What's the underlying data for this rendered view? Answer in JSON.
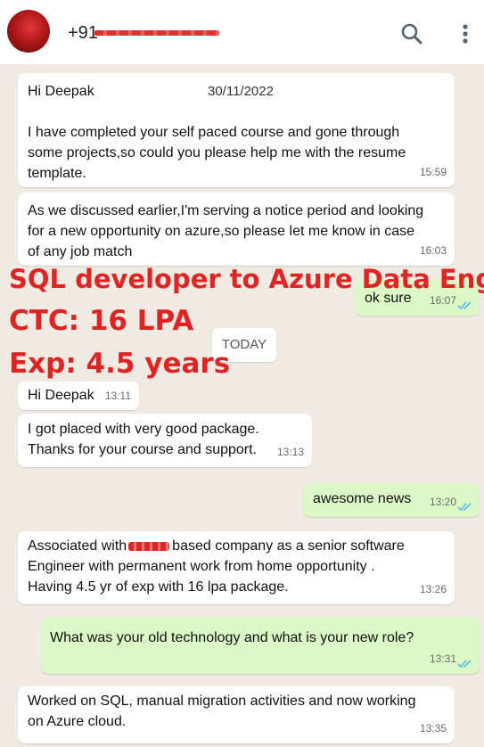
{
  "header": {
    "contact_name": "+91",
    "icons": {
      "search": "search-icon",
      "menu": "more-vertical-icon"
    }
  },
  "messages": [
    {
      "dir": "in",
      "lines": [
        "Hi Deepak",
        "",
        "I have completed your self paced course and gone through",
        "some projects,so could you please help me with the resume",
        "template."
      ],
      "date": "30/11/2022",
      "time": "15:59"
    },
    {
      "dir": "in",
      "lines": [
        "As we discussed earlier,I'm serving a notice period and looking",
        "for a new opportunity on azure,so please let me know in case",
        "of any job match"
      ],
      "time": "16:03"
    },
    {
      "dir": "out",
      "text": "ok sure",
      "time": "16:07"
    },
    {
      "dir": "in",
      "text": "Hi Deepak",
      "time": "13:11"
    },
    {
      "dir": "in",
      "lines": [
        "I got placed with very good package.",
        "Thanks for your course and support."
      ],
      "time": "13:13"
    },
    {
      "dir": "out",
      "text": "awesome news",
      "time": "13:20"
    },
    {
      "dir": "in",
      "line1_before": "Associated with",
      "line1_after": "based company as a senior software",
      "lines": [
        "Engineer with permanent work from home opportunity .",
        "Having 4.5 yr of exp with 16 lpa package."
      ],
      "time": "13:26"
    },
    {
      "dir": "out",
      "text": "What was your old technology and what is your new role?",
      "time": "13:31"
    },
    {
      "dir": "in",
      "lines": [
        "Worked on SQL, manual migration activities and now working",
        "on Azure cloud."
      ],
      "time": "13:35"
    }
  ],
  "system_chip": "TODAY",
  "overlay": {
    "line1": "SQL developer to Azure Data Eng",
    "line2": "CTC: 16 LPA",
    "line3": "Exp: 4.5 years",
    "color": "#e02424"
  },
  "colors": {
    "incoming": "#ffffff",
    "outgoing": "#dcf8c6",
    "background": "#efeae2",
    "tick": "#53bdeb"
  }
}
